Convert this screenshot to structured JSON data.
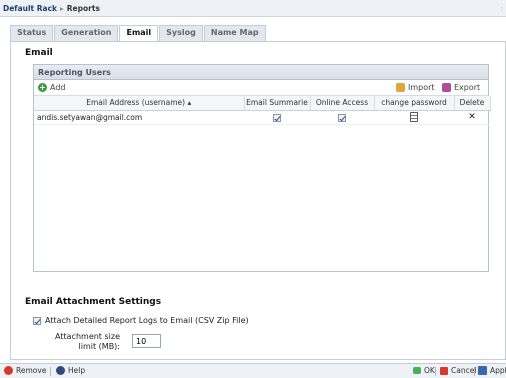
{
  "breadcrumb": {
    "root": "Default Rack",
    "separator": "▸",
    "current": "Reports"
  },
  "tabs": [
    {
      "label": "Status"
    },
    {
      "label": "Generation"
    },
    {
      "label": "Email",
      "active": true
    },
    {
      "label": "Syslog"
    },
    {
      "label": "Name Map"
    }
  ],
  "email_section": {
    "title": "Email"
  },
  "grid": {
    "title": "Reporting Users",
    "add_label": "Add",
    "import_label": "Import",
    "export_label": "Export",
    "columns": [
      "Email Address (username) ▴",
      "Email Summarie",
      "Online Access",
      "change password",
      "Delete"
    ],
    "rows": [
      {
        "email": "andis.setyawan@gmail.com",
        "email_summaries": true,
        "online_access": true
      }
    ]
  },
  "attachment": {
    "title": "Email Attachment Settings",
    "attach_label": "Attach Detailed Report Logs to Email (CSV Zip File)",
    "attach_checked": true,
    "size_label": "Attachment size limit (MB):",
    "size_value": "10"
  },
  "footer": {
    "remove_label": "Remove",
    "help_label": "Help",
    "ok_label": "OK",
    "cancel_label": "Cancel",
    "apply_label": "Apply"
  },
  "colors": {
    "accent": "#1d3f72",
    "add": "#3a9a3a",
    "remove": "#d23a2e"
  }
}
